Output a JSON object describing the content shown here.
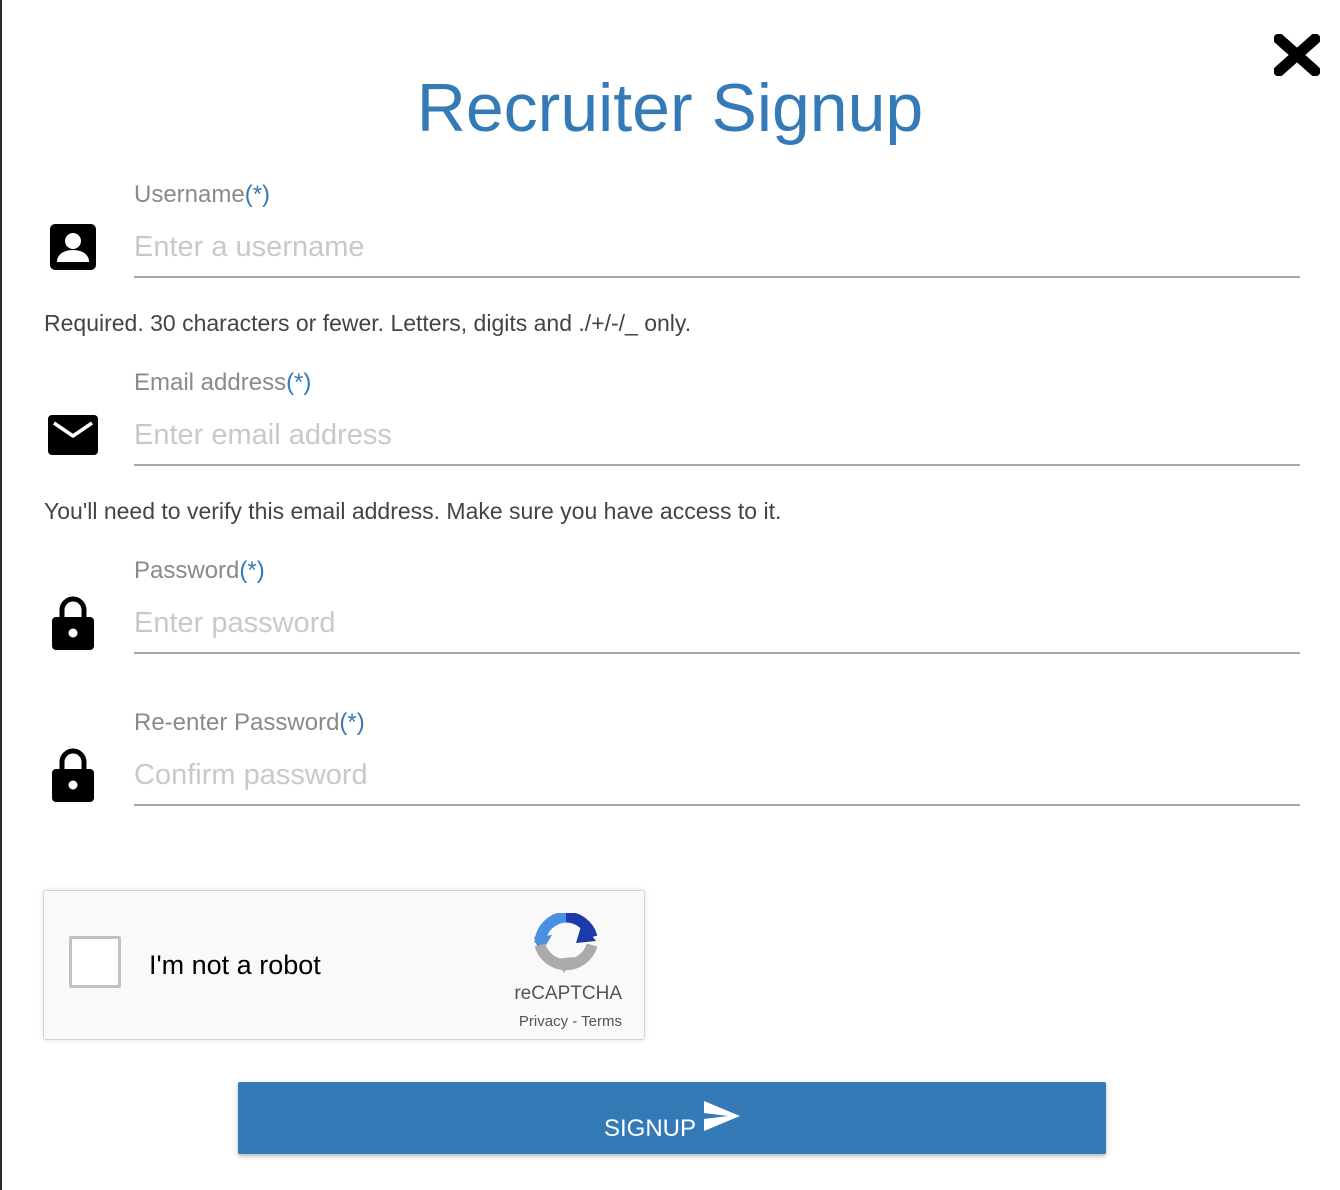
{
  "page": {
    "title": "Recruiter Signup"
  },
  "close": {
    "icon": "close-icon"
  },
  "form": {
    "required_marker": "(*)",
    "username": {
      "label": "Username",
      "placeholder": "Enter a username",
      "value": "",
      "icon": "account-box-icon",
      "help": "Required. 30 characters or fewer. Letters, digits and ./+/-/_ only."
    },
    "email": {
      "label": "Email address",
      "placeholder": "Enter email address",
      "value": "",
      "icon": "envelope-icon",
      "help": "You'll need to verify this email address. Make sure you have access to it."
    },
    "password": {
      "label": "Password",
      "placeholder": "Enter password",
      "value": "",
      "icon": "lock-icon"
    },
    "password_confirm": {
      "label": "Re-enter Password",
      "placeholder": "Confirm password",
      "value": "",
      "icon": "lock-icon"
    }
  },
  "recaptcha": {
    "label": "I'm not a robot",
    "brand": "reCAPTCHA",
    "privacy": "Privacy",
    "separator": " - ",
    "terms": "Terms",
    "checked": false,
    "icon": "recaptcha-logo-icon"
  },
  "submit": {
    "label": "SIGNUP",
    "icon": "send-icon"
  },
  "colors": {
    "accent": "#337ab7",
    "label": "#8a8a8a",
    "placeholder": "#c9c9c9",
    "help_text": "#444444"
  }
}
